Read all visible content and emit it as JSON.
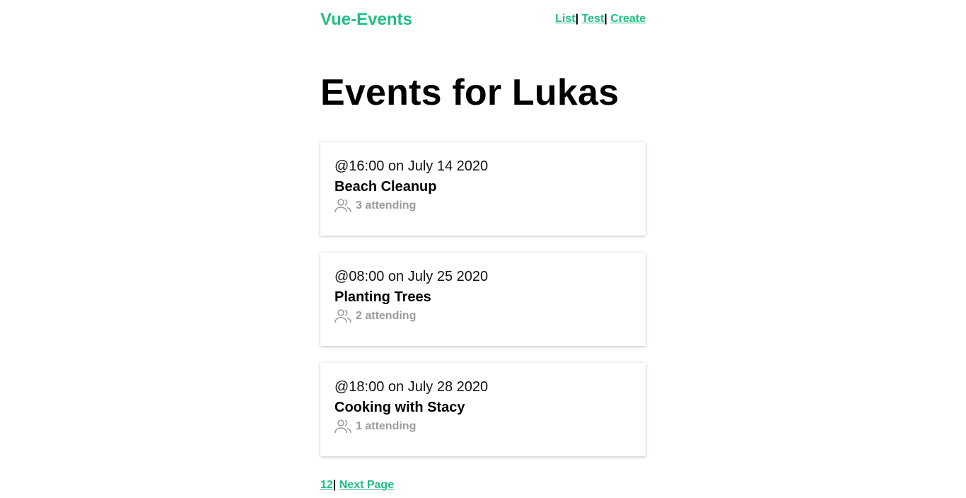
{
  "nav": {
    "brand": "Vue-Events",
    "links": [
      "List",
      "Test",
      "Create"
    ],
    "separator": "|"
  },
  "page": {
    "title": "Events for Lukas"
  },
  "events": [
    {
      "time": "@16:00 on July 14 2020",
      "title": "Beach Cleanup",
      "attending": "3 attending"
    },
    {
      "time": "@08:00 on July 25 2020",
      "title": "Planting Trees",
      "attending": "2 attending"
    },
    {
      "time": "@18:00 on July 28 2020",
      "title": "Cooking with Stacy",
      "attending": "1 attending"
    }
  ],
  "pager": {
    "pages": "12",
    "separator": "|",
    "next": "Next Page"
  },
  "icons": {
    "attendees": "users-icon"
  },
  "colors": {
    "accent": "#1fbf81",
    "muted": "#9a9a9a"
  }
}
